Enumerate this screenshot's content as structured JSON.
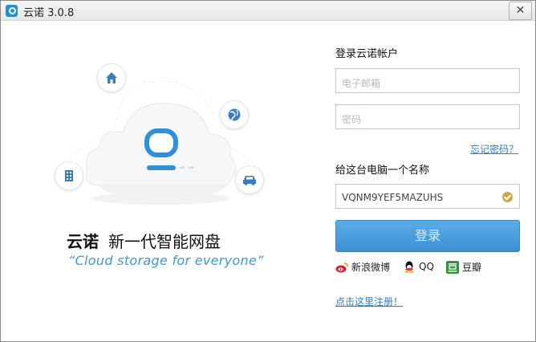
{
  "window": {
    "title": "云诺 3.0.8",
    "close_glyph": "✕"
  },
  "icons": [
    "app-icon",
    "home-icon",
    "globe-icon",
    "building-icon",
    "car-icon",
    "cloud-logo",
    "weibo-icon",
    "qq-icon",
    "douban-icon",
    "check-icon",
    "close-icon"
  ],
  "promo": {
    "brand": "云诺",
    "slogan": "新一代智能网盘",
    "tagline": "“Cloud storage for everyone”"
  },
  "login": {
    "heading": "登录云诺帐户",
    "email_placeholder": "电子邮箱",
    "password_placeholder": "密码",
    "forgot_link": "忘记密码？",
    "computer_name_label": "给这台电脑一个名称",
    "computer_name_value": "VQNM9YEF5MAZUHS",
    "login_button": "登录",
    "register_link": "点击这里注册！"
  },
  "social": {
    "weibo": "新浪微博",
    "qq": "QQ",
    "douban": "豆瓣"
  },
  "colors": {
    "accent": "#3d8fd3",
    "link": "#2c7fc0",
    "tagline": "#3a9ad9",
    "check": "#c7a944"
  }
}
